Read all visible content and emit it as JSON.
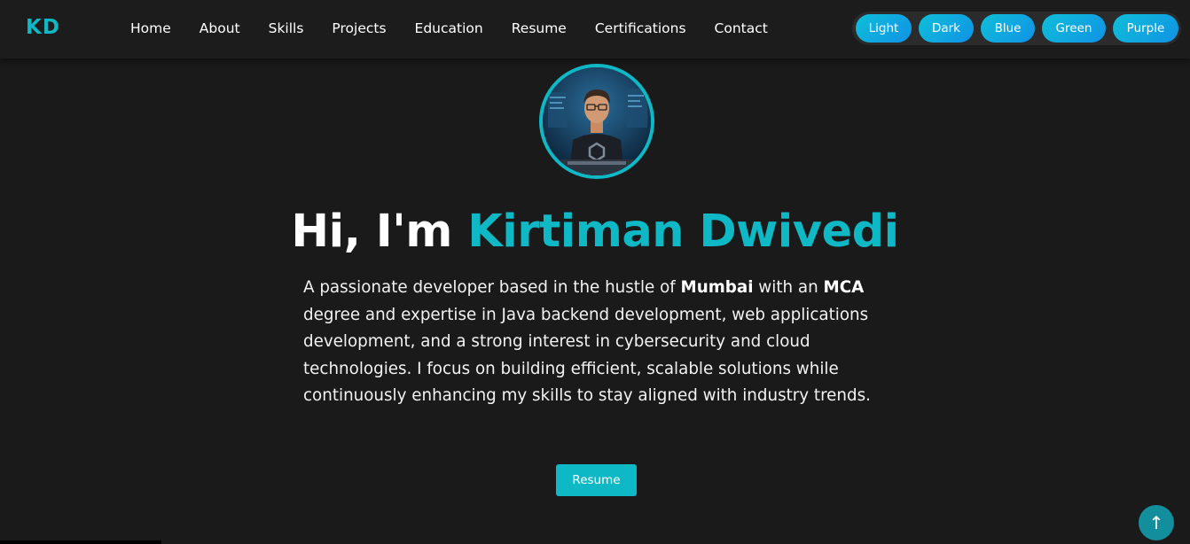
{
  "logo": "KD",
  "nav": {
    "items": [
      {
        "label": "Home"
      },
      {
        "label": "About"
      },
      {
        "label": "Skills"
      },
      {
        "label": "Projects"
      },
      {
        "label": "Education"
      },
      {
        "label": "Resume"
      },
      {
        "label": "Certifications"
      },
      {
        "label": "Contact"
      }
    ]
  },
  "themes": [
    {
      "label": "Light"
    },
    {
      "label": "Dark"
    },
    {
      "label": "Blue"
    },
    {
      "label": "Green"
    },
    {
      "label": "Purple"
    }
  ],
  "hero": {
    "greeting": "Hi, I'm ",
    "name": "Kirtiman Dwivedi",
    "desc_part1": "A passionate developer based in the hustle of ",
    "city": "Mumbai",
    "desc_part2": " with an ",
    "degree": "MCA",
    "desc_part3": " degree and expertise in Java backend development, web applications development, and a strong interest in cybersecurity and cloud technologies. I focus on building efficient, scalable solutions while continuously enhancing my skills to stay aligned with industry trends.",
    "resume_label": "Resume"
  },
  "scroll_top_icon": "↑",
  "colors": {
    "accent": "#0fb8c5",
    "background": "#1a1a1a",
    "navbar": "#1c1c1c",
    "theme_button": "#12a8e0"
  },
  "icons": {
    "avatar": "profile-avatar-image",
    "scroll_top": "arrow-up-icon"
  }
}
